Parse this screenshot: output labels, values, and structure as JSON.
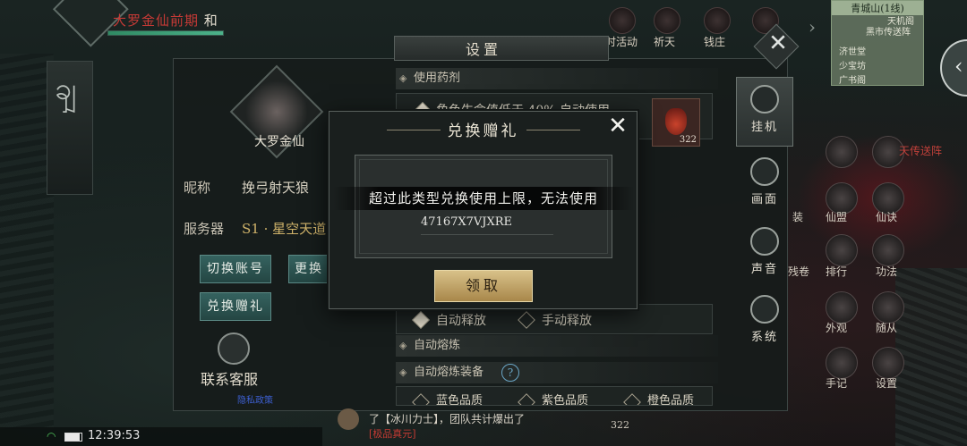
{
  "hud": {
    "player_title": "大罗金仙前期",
    "player_tag": "和",
    "hp_fraction": 1.0,
    "top_icons": [
      {
        "name": "limited-event",
        "label": "限时活动"
      },
      {
        "name": "prayer",
        "label": "祈天"
      },
      {
        "name": "money-shop",
        "label": "钱庄"
      }
    ],
    "minimap": {
      "title": "青城山(1线)",
      "labels": [
        "黑市传送阵",
        "天机阁",
        "济世堂",
        "少宝坊",
        "广书阁"
      ]
    }
  },
  "settings": {
    "title": "设置",
    "profile": {
      "realm": "大罗金仙",
      "nickname_label": "昵称",
      "nickname_value": "挽弓射天狼",
      "server_label": "服务器",
      "server_value": "S1 · 星空天道"
    },
    "buttons": {
      "switch_account": "切换账号",
      "change": "更换",
      "redeem_gift": "兑换赠礼"
    },
    "support": {
      "label": "联系客服",
      "link": "隐私政策"
    },
    "sections": {
      "use_potion": "使用药剂",
      "potion_rule": "角色生命值低于 40% 自动使用",
      "auto_refine": "自动熔炼",
      "auto_refine_equip": "自动熔炼装备"
    },
    "release_options": {
      "auto": "自动释放",
      "manual": "手动释放"
    },
    "quality_options": [
      "蓝色品质",
      "紫色品质",
      "橙色品质"
    ],
    "potion_count": "322",
    "tabs": [
      {
        "id": "idle",
        "label": "挂机",
        "active": true
      },
      {
        "id": "graphics",
        "label": "画面",
        "active": false
      },
      {
        "id": "sound",
        "label": "声音",
        "active": false
      },
      {
        "id": "system",
        "label": "系统",
        "active": false
      }
    ]
  },
  "right_menu": [
    {
      "label": "仙盟"
    },
    {
      "label": "仙诀"
    },
    {
      "label": "排行"
    },
    {
      "label": "功法"
    },
    {
      "label": "外观"
    },
    {
      "label": "随从"
    },
    {
      "label": "手记"
    },
    {
      "label": "设置"
    }
  ],
  "right_partial": {
    "label_1": "天传送阵",
    "label_2": "装",
    "label_3": "残卷"
  },
  "modal": {
    "title": "兑换赠礼",
    "toast": "超过此类型兑换使用上限，无法使用",
    "code_value": "47167X7VJXRE",
    "claim_button": "领取"
  },
  "chat": {
    "line1": "了【冰川力士】，团队共计爆出了",
    "line2": "[极品真元]"
  },
  "status_bar": {
    "time": "12:39:53",
    "counter": "322"
  },
  "colors": {
    "accent_gold": "#d0b36a",
    "hud_name_red": "#c63a36",
    "button_teal": "#35625f"
  }
}
